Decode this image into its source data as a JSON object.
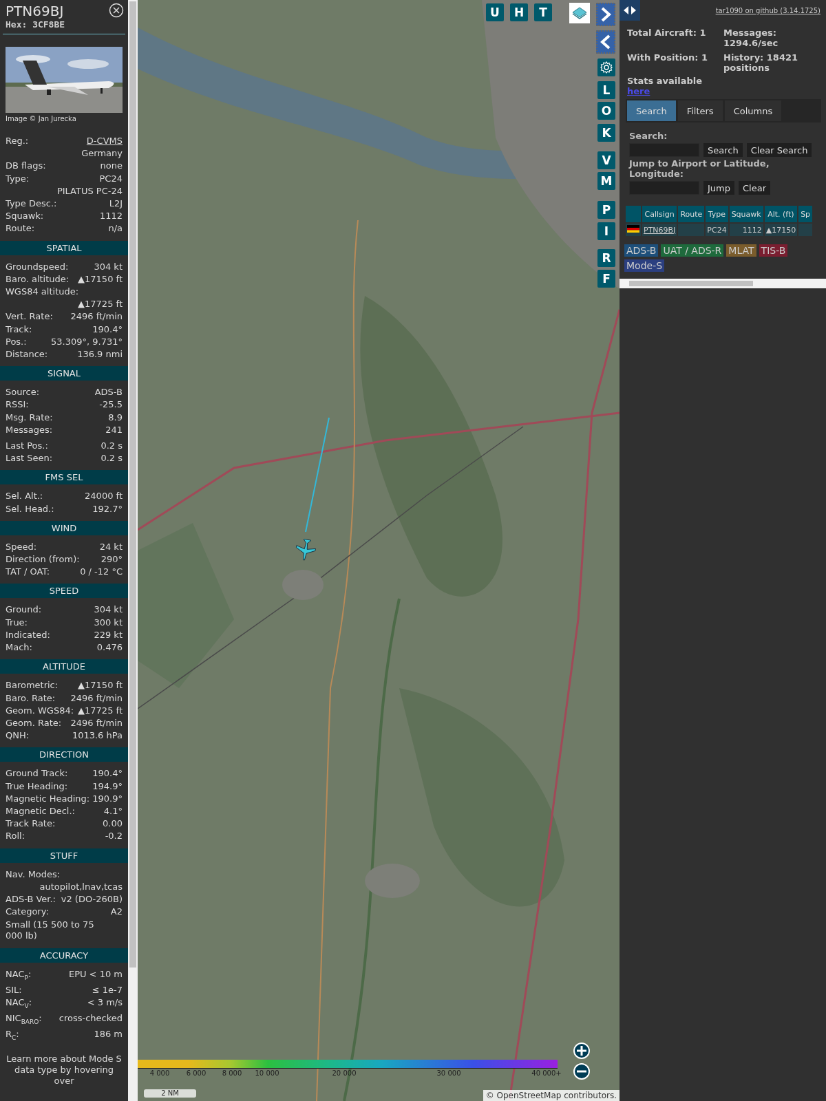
{
  "sidebar": {
    "callsign": "PTN69BJ",
    "hex": "Hex: 3CF8BE",
    "photo": {
      "kind": "picture",
      "credit": "Image © Jan Jurecka"
    },
    "info_rows": [
      {
        "kind": "link",
        "label": "Reg.:",
        "value": "D-CVMS"
      },
      {
        "kind": "value",
        "value": "Germany"
      },
      {
        "kind": "pair",
        "label": "DB flags:",
        "value": "none"
      },
      {
        "kind": "pair",
        "label": "Type:",
        "value": "PC24"
      },
      {
        "kind": "value",
        "value": "PILATUS PC-24"
      },
      {
        "kind": "pair",
        "label": "Type Desc.:",
        "value": "L2J"
      },
      {
        "kind": "pair",
        "label": "Squawk:",
        "value": "1112"
      },
      {
        "kind": "pair",
        "label": "Route:",
        "value": "n/a"
      }
    ],
    "sections": [
      {
        "title": "SPATIAL",
        "rows": [
          {
            "kind": "pair",
            "label": "Groundspeed:",
            "value": "304 kt"
          },
          {
            "kind": "pair",
            "label": "Baro. altitude:",
            "value": "▲17150 ft"
          },
          {
            "kind": "stacked",
            "label": "WGS84 altitude:",
            "value": "▲17725 ft"
          },
          {
            "kind": "pair",
            "label": "Vert. Rate:",
            "value": "2496 ft/min"
          },
          {
            "kind": "pair",
            "label": "Track:",
            "value": "190.4°"
          },
          {
            "kind": "pair",
            "label": "Pos.:",
            "value": "53.309°, 9.731°"
          },
          {
            "kind": "pair",
            "label": "Distance:",
            "value": "136.9 nmi"
          }
        ]
      },
      {
        "title": "SIGNAL",
        "rows": [
          {
            "kind": "pair",
            "label": "Source:",
            "value": "ADS-B"
          },
          {
            "kind": "pair",
            "label": "RSSI:",
            "value": "-25.5"
          },
          {
            "kind": "pair",
            "label": "Msg. Rate:",
            "value": "8.9"
          },
          {
            "kind": "pair",
            "label": "Messages:",
            "value": "241"
          },
          {
            "kind": "gap"
          },
          {
            "kind": "pair",
            "label": "Last Pos.:",
            "value": "0.2 s"
          },
          {
            "kind": "pair",
            "label": "Last Seen:",
            "value": "0.2 s"
          }
        ]
      },
      {
        "title": "FMS SEL",
        "rows": [
          {
            "kind": "pair",
            "label": "Sel. Alt.:",
            "value": "24000 ft"
          },
          {
            "kind": "pair",
            "label": "Sel. Head.:",
            "value": "192.7°"
          }
        ]
      },
      {
        "title": "WIND",
        "rows": [
          {
            "kind": "pair",
            "label": "Speed:",
            "value": "24 kt"
          },
          {
            "kind": "pair",
            "label": "Direction (from):",
            "value": "290°"
          },
          {
            "kind": "pair",
            "label": "TAT / OAT:",
            "value": "0 / -12 °C"
          }
        ]
      },
      {
        "title": "SPEED",
        "rows": [
          {
            "kind": "pair",
            "label": "Ground:",
            "value": "304 kt"
          },
          {
            "kind": "pair",
            "label": "True:",
            "value": "300 kt"
          },
          {
            "kind": "pair",
            "label": "Indicated:",
            "value": "229 kt"
          },
          {
            "kind": "pair",
            "label": "Mach:",
            "value": "0.476"
          }
        ]
      },
      {
        "title": "ALTITUDE",
        "rows": [
          {
            "kind": "pair",
            "label": "Barometric:",
            "value": "▲17150 ft"
          },
          {
            "kind": "pair",
            "label": "Baro. Rate:",
            "value": "2496 ft/min"
          },
          {
            "kind": "pair",
            "label": "Geom. WGS84:",
            "value": "▲17725 ft"
          },
          {
            "kind": "pair",
            "label": "Geom. Rate:",
            "value": "2496 ft/min"
          },
          {
            "kind": "pair",
            "label": "QNH:",
            "value": "1013.6 hPa"
          }
        ]
      },
      {
        "title": "DIRECTION",
        "rows": [
          {
            "kind": "pair",
            "label": "Ground Track:",
            "value": "190.4°"
          },
          {
            "kind": "pair",
            "label": "True Heading:",
            "value": "194.9°"
          },
          {
            "kind": "pair",
            "label": "Magnetic Heading:",
            "value": "190.9°"
          },
          {
            "kind": "pair",
            "label": "Magnetic Decl.:",
            "value": "4.1°"
          },
          {
            "kind": "pair",
            "label": "Track Rate:",
            "value": "0.00"
          },
          {
            "kind": "pair",
            "label": "Roll:",
            "value": "-0.2"
          }
        ]
      },
      {
        "title": "STUFF",
        "rows": [
          {
            "kind": "stacked",
            "label": "Nav. Modes:",
            "value": "autopilot,lnav,tcas"
          },
          {
            "kind": "pair",
            "label": "ADS-B Ver.:",
            "value": "v2 (DO-260B)"
          },
          {
            "kind": "pair",
            "label": "Category:",
            "value": "A2"
          },
          {
            "kind": "text",
            "value": "Small (15 500 to 75 000 lb)"
          }
        ]
      },
      {
        "title": "ACCURACY",
        "rows": [
          {
            "kind": "pair",
            "label": "NAC$_{P}$:",
            "value": "EPU < 10 m"
          },
          {
            "kind": "pair",
            "label": "SIL:",
            "value": "≤ 1e-7"
          },
          {
            "kind": "pair",
            "label": "NAC$_{V}$:",
            "value": "< 3 m/s"
          },
          {
            "kind": "pair",
            "label": "NIC$_{BARO}$:",
            "value": "cross-checked"
          },
          {
            "kind": "pair",
            "label": "R$_{C}$:",
            "value": "186 m"
          }
        ]
      }
    ],
    "footer_note": "Learn more about Mode S data type by hovering over"
  },
  "map": {
    "top_buttons": [
      {
        "label": "U"
      },
      {
        "label": "H"
      },
      {
        "label": "T"
      }
    ],
    "side_buttons": [
      {
        "label": "L"
      },
      {
        "label": "O"
      },
      {
        "label": "K"
      },
      {
        "label": "V"
      },
      {
        "label": "M"
      },
      {
        "label": "P"
      },
      {
        "label": "I"
      },
      {
        "label": "R"
      },
      {
        "label": "F"
      }
    ],
    "altitude_legend": [
      "4 000",
      "6 000",
      "8 000",
      "10 000",
      "20 000",
      "30 000",
      "40 000+"
    ],
    "scale": "2 NM",
    "attribution": {
      "prefix": "©",
      "link": "OpenStreetMap",
      "suffix": "contributors."
    }
  },
  "panel": {
    "github_link": "tar1090 on github (3.14.1725)",
    "stats": [
      {
        "label": "Total Aircraft:",
        "value": "1"
      },
      {
        "label": "Messages:",
        "value": "1294.6/sec"
      },
      {
        "label": "With Position:",
        "value": "1"
      },
      {
        "label": "History:",
        "value": "18421 positions"
      }
    ],
    "stats_note": "Stats available",
    "stats_link": "here",
    "tabs": [
      {
        "label": "Search",
        "selected": true
      },
      {
        "label": "Filters",
        "selected": false
      },
      {
        "label": "Columns",
        "selected": false
      }
    ],
    "search_label": "Search:",
    "search_button": "Search",
    "clear_search_button": "Clear Search",
    "jump_label": "Jump to Airport or Latitude, Longitude:",
    "jump_button": "Jump",
    "clear_button": "Clear",
    "table": {
      "columns": [
        "Callsign",
        "Route",
        "Type",
        "Squawk",
        "Alt. (ft)",
        "Sp"
      ],
      "rows": [
        {
          "callsign": "PTN69BJ",
          "route": "",
          "type": "PC24",
          "squawk": "1112",
          "altitude": "▲17150"
        }
      ]
    },
    "sources": [
      {
        "label": "ADS-B",
        "color": "#1d4f7a"
      },
      {
        "label": "UAT / ADS-R",
        "color": "#1e6a3c"
      },
      {
        "label": "MLAT",
        "color": "#7a5c2c"
      },
      {
        "label": "TIS-B",
        "color": "#7a1e30"
      },
      {
        "label": "Mode-S",
        "color": "#2b3f80"
      }
    ]
  }
}
